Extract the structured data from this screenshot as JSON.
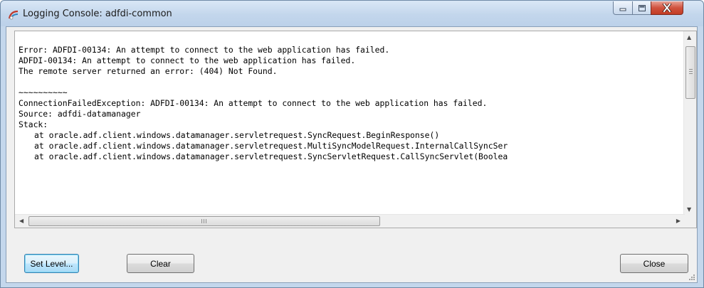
{
  "window": {
    "title": "Logging Console: adfdi-common",
    "controls": {
      "minimize_icon": "minimize-icon",
      "maximize_icon": "maximize-icon",
      "close_icon": "close-icon"
    }
  },
  "log": {
    "lines": [
      {
        "text": "",
        "indent": false
      },
      {
        "text": "Error: ADFDI-00134: An attempt to connect to the web application has failed.",
        "indent": false
      },
      {
        "text": "ADFDI-00134: An attempt to connect to the web application has failed.",
        "indent": false
      },
      {
        "text": "The remote server returned an error: (404) Not Found.",
        "indent": false
      },
      {
        "text": "",
        "indent": false
      },
      {
        "text": "~~~~~~~~~~",
        "indent": false
      },
      {
        "text": "ConnectionFailedException: ADFDI-00134: An attempt to connect to the web application has failed.",
        "indent": false
      },
      {
        "text": "Source: adfdi-datamanager",
        "indent": false
      },
      {
        "text": "Stack:",
        "indent": false
      },
      {
        "text": "at oracle.adf.client.windows.datamanager.servletrequest.SyncRequest.BeginResponse()",
        "indent": true
      },
      {
        "text": "at oracle.adf.client.windows.datamanager.servletrequest.MultiSyncModelRequest.InternalCallSyncSer",
        "indent": true
      },
      {
        "text": "at oracle.adf.client.windows.datamanager.servletrequest.SyncServletRequest.CallSyncServlet(Boolea",
        "indent": true
      }
    ]
  },
  "scrollbars": {
    "vertical_grip": "III",
    "horizontal_grip": "III"
  },
  "buttons": {
    "set_level": "Set Level...",
    "clear": "Clear",
    "close": "Close"
  },
  "colors": {
    "title_bar": "#c3d6ec",
    "close_button": "#c94a31",
    "focus_button": "#bee6fd"
  }
}
